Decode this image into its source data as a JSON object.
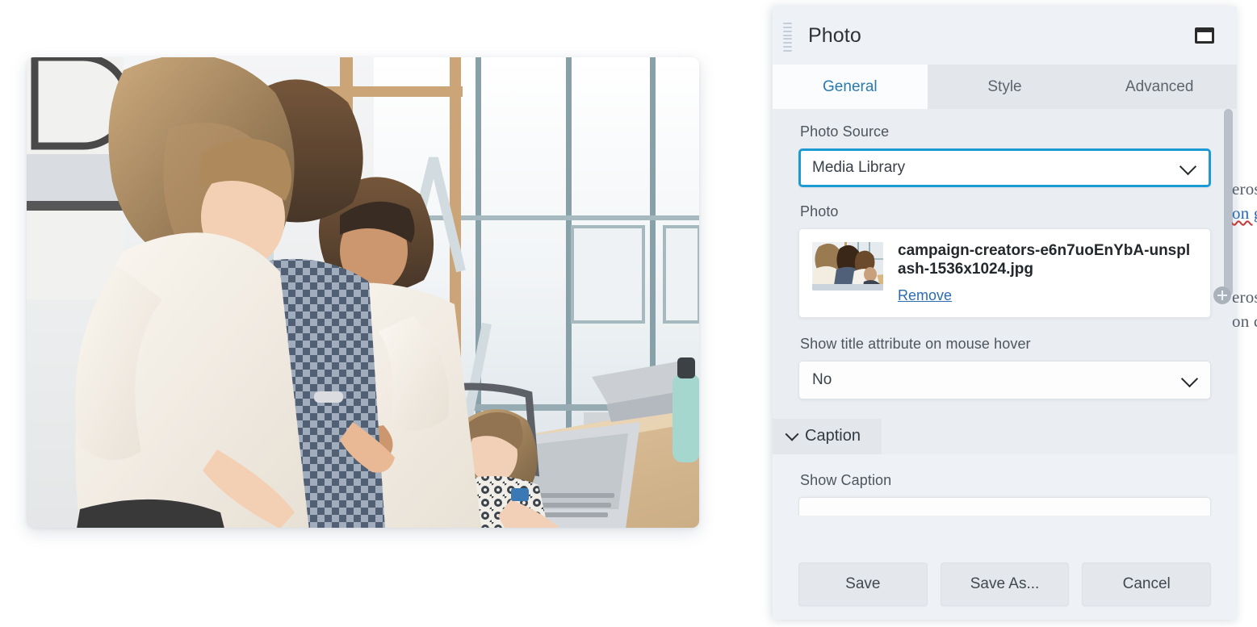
{
  "panel": {
    "title": "Photo",
    "drag_handle_icon": "drag-handle-icon",
    "window_restore_icon": "window-restore-icon",
    "tabs": [
      {
        "label": "General",
        "active": true
      },
      {
        "label": "Style",
        "active": false
      },
      {
        "label": "Advanced",
        "active": false
      }
    ],
    "general": {
      "photo_source": {
        "label": "Photo Source",
        "value": "Media Library",
        "focused": true,
        "chevron_icon": "chevron-down-icon"
      },
      "photo": {
        "label": "Photo",
        "filename": "campaign-creators-e6n7uoEnYbA-unsplash-1536x1024.jpg",
        "remove_label": "Remove",
        "thumbnail_icon": "photo-thumbnail"
      },
      "title_attribute": {
        "label": "Show title attribute on mouse hover",
        "value": "No",
        "chevron_icon": "chevron-down-icon"
      }
    },
    "caption": {
      "header_label": "Caption",
      "expanded": true,
      "collapse_icon": "chevron-down-icon",
      "show_caption_label": "Show Caption"
    },
    "footer": {
      "save_label": "Save",
      "save_as_label": "Save As...",
      "cancel_label": "Cancel"
    },
    "scrollbar": {
      "name": "panel-vertical-scrollbar"
    },
    "resize_handle": {
      "name": "add-row-plus-handle",
      "glyph": "+"
    }
  },
  "canvas": {
    "photo_alt": "Four colleagues collaborating around a laptop at a bright office table",
    "background_text": [
      {
        "text": "eros",
        "link": false
      },
      {
        "text": "on g",
        "link": true
      },
      {
        "text": "eros",
        "link": false
      },
      {
        "text": "on c",
        "link": false
      }
    ]
  },
  "colors": {
    "accent_blue": "#1b9ad4",
    "tab_active_text": "#2a7ab0",
    "link_blue": "#2b6cb0",
    "panel_bg": "#eef1f5",
    "section_bg": "#eaedf1",
    "tab_strip_bg": "#e3e7ec"
  }
}
